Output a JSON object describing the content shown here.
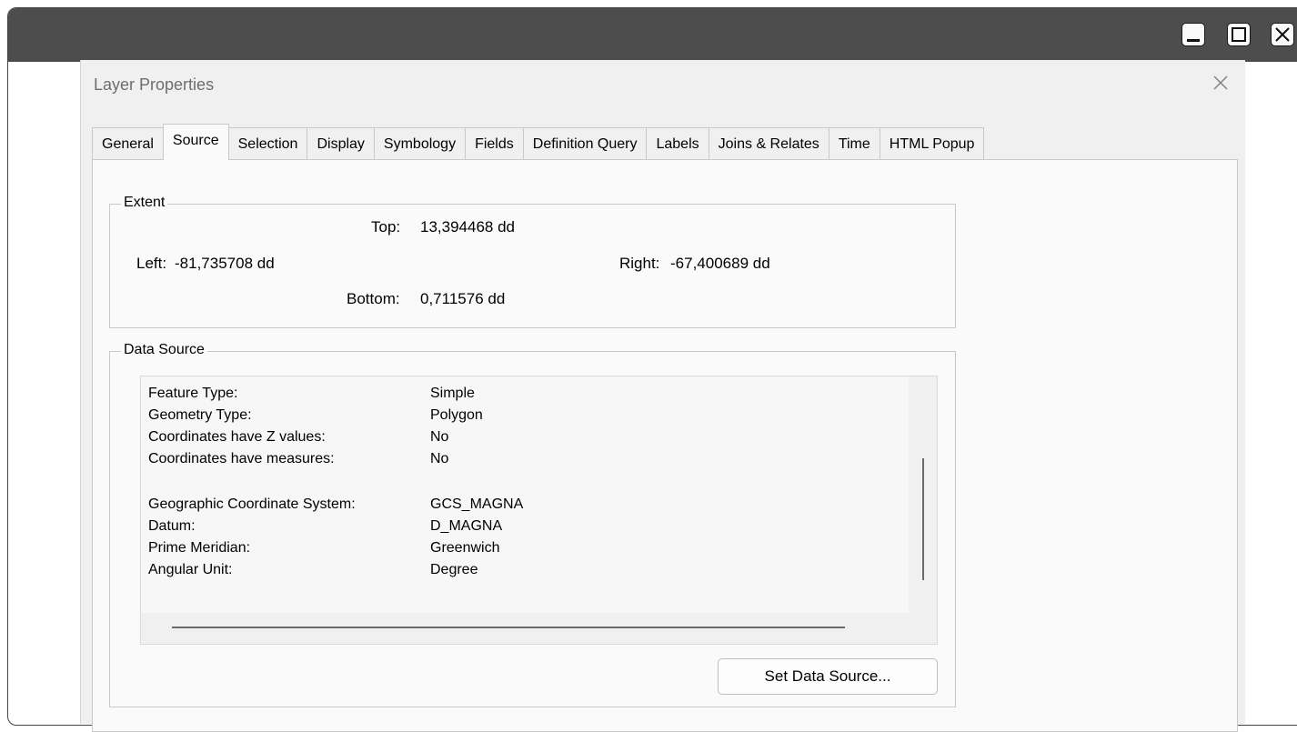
{
  "window": {
    "controls": [
      "minimize-icon",
      "maximize-icon",
      "close-icon"
    ]
  },
  "dialog": {
    "title": "Layer Properties",
    "tabs": [
      {
        "label": "General"
      },
      {
        "label": "Source"
      },
      {
        "label": "Selection"
      },
      {
        "label": "Display"
      },
      {
        "label": "Symbology"
      },
      {
        "label": "Fields"
      },
      {
        "label": "Definition Query"
      },
      {
        "label": "Labels"
      },
      {
        "label": "Joins & Relates"
      },
      {
        "label": "Time"
      },
      {
        "label": "HTML Popup"
      }
    ],
    "active_tab": "Source"
  },
  "extent": {
    "legend": "Extent",
    "top_label": "Top:",
    "top_value": "13,394468 dd",
    "left_label": "Left:",
    "left_value": "-81,735708 dd",
    "right_label": "Right:",
    "right_value": "-67,400689 dd",
    "bottom_label": "Bottom:",
    "bottom_value": "0,711576 dd"
  },
  "data_source": {
    "legend": "Data Source",
    "rows": [
      {
        "label": "Feature Type:",
        "value": "Simple"
      },
      {
        "label": "Geometry Type:",
        "value": "Polygon"
      },
      {
        "label": "Coordinates have Z values:",
        "value": "No"
      },
      {
        "label": "Coordinates have measures:",
        "value": "No"
      },
      {
        "label": "Geographic Coordinate System:",
        "value": "GCS_MAGNA"
      },
      {
        "label": "Datum:",
        "value": "D_MAGNA"
      },
      {
        "label": "Prime Meridian:",
        "value": "Greenwich"
      },
      {
        "label": "Angular Unit:",
        "value": "Degree"
      }
    ],
    "set_button": "Set Data Source..."
  }
}
